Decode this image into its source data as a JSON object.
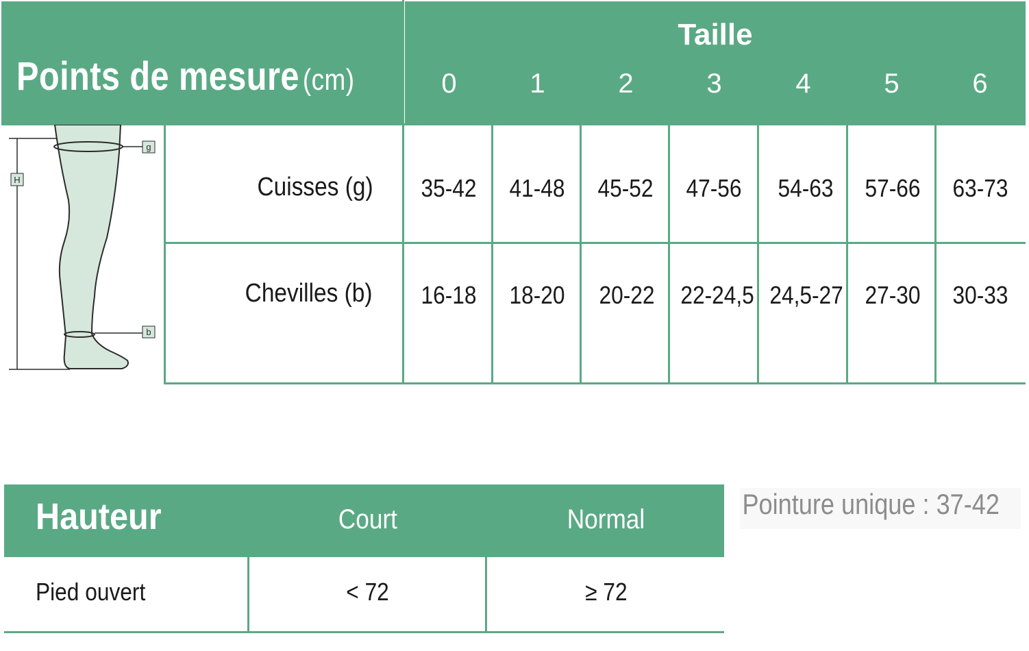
{
  "measure_table": {
    "title": "Points de mesure",
    "title_unit": "(cm)",
    "size_heading": "Taille",
    "sizes": [
      "0",
      "1",
      "2",
      "3",
      "4",
      "5",
      "6"
    ],
    "rows": [
      {
        "label": "Cuisses (g)",
        "values": [
          "35-42",
          "41-48",
          "45-52",
          "47-56",
          "54-63",
          "57-66",
          "63-73"
        ]
      },
      {
        "label": "Chevilles (b)",
        "values": [
          "16-18",
          "18-20",
          "20-22",
          "22-24,5",
          "24,5-27",
          "27-30",
          "30-33"
        ]
      }
    ]
  },
  "leg_diagram": {
    "markers": {
      "height": "H",
      "thigh": "g",
      "ankle": "b"
    }
  },
  "height_table": {
    "title": "Hauteur",
    "columns": [
      "Court",
      "Normal"
    ],
    "rows": [
      {
        "label": "Pied ouvert",
        "values": [
          "< 72",
          "≥ 72"
        ]
      }
    ]
  },
  "shoe_size_note": "Pointure unique : 37-42",
  "colors": {
    "header_green": "#5aa985",
    "leg_fill": "#d6e8dc",
    "note_gray": "#8c8c8c"
  }
}
